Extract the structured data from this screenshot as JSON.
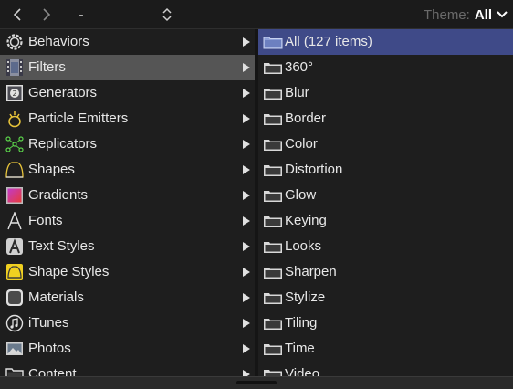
{
  "toolbar": {
    "path_text": "-",
    "theme_label": "Theme:",
    "theme_value": "All"
  },
  "categories": [
    {
      "label": "Behaviors",
      "icon": "gear-icon"
    },
    {
      "label": "Filters",
      "icon": "film-icon",
      "selected": true
    },
    {
      "label": "Generators",
      "icon": "generator-icon"
    },
    {
      "label": "Particle Emitters",
      "icon": "particle-icon"
    },
    {
      "label": "Replicators",
      "icon": "replicator-icon"
    },
    {
      "label": "Shapes",
      "icon": "shape-icon"
    },
    {
      "label": "Gradients",
      "icon": "gradient-icon"
    },
    {
      "label": "Fonts",
      "icon": "font-icon"
    },
    {
      "label": "Text Styles",
      "icon": "text-style-icon"
    },
    {
      "label": "Shape Styles",
      "icon": "shape-style-icon"
    },
    {
      "label": "Materials",
      "icon": "material-icon"
    },
    {
      "label": "iTunes",
      "icon": "music-icon"
    },
    {
      "label": "Photos",
      "icon": "photo-icon"
    },
    {
      "label": "Content",
      "icon": "folder-icon"
    }
  ],
  "filters": [
    {
      "label": "All (127 items)",
      "selected": true
    },
    {
      "label": "360°"
    },
    {
      "label": "Blur"
    },
    {
      "label": "Border"
    },
    {
      "label": "Color"
    },
    {
      "label": "Distortion"
    },
    {
      "label": "Glow"
    },
    {
      "label": "Keying"
    },
    {
      "label": "Looks"
    },
    {
      "label": "Sharpen"
    },
    {
      "label": "Stylize"
    },
    {
      "label": "Tiling"
    },
    {
      "label": "Time"
    },
    {
      "label": "Video"
    }
  ],
  "colors": {
    "selected_category": "#555555",
    "selected_folder": "#3f4a88",
    "particle_icon": "#e8c43a",
    "replicator_icon": "#5ad14a",
    "shape_style_icon": "#f0d020"
  }
}
